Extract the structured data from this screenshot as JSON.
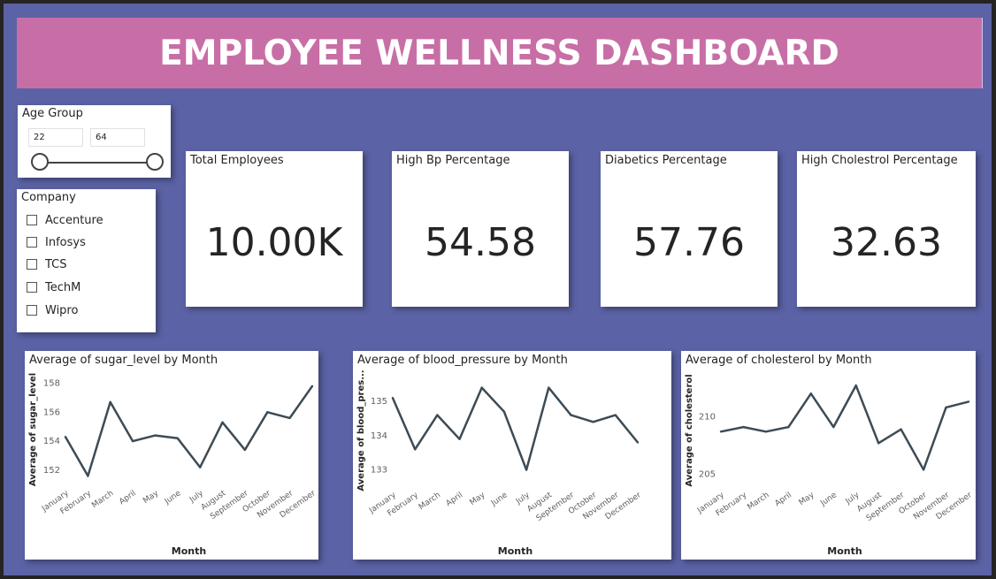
{
  "dashboard": {
    "title": "EMPLOYEE WELLNESS DASHBOARD"
  },
  "colors": {
    "background": "#5b62a5",
    "title_band": "#c86ea6",
    "line": "#3d4b55",
    "card": "#ffffff"
  },
  "age_slicer": {
    "title": "Age Group",
    "min": "22",
    "max": "64"
  },
  "company_slicer": {
    "title": "Company",
    "items": [
      {
        "label": "Accenture"
      },
      {
        "label": "Infosys"
      },
      {
        "label": "TCS"
      },
      {
        "label": "TechM"
      },
      {
        "label": "Wipro"
      }
    ]
  },
  "kpis": [
    {
      "label": "Total Employees",
      "value": "10.00K"
    },
    {
      "label": "High Bp Percentage",
      "value": "54.58"
    },
    {
      "label": "Diabetics Percentage",
      "value": "57.76"
    },
    {
      "label": "High Cholestrol Percentage",
      "value": "32.63"
    }
  ],
  "chart_data": [
    {
      "type": "line",
      "title": "Average of sugar_level by Month",
      "xlabel": "Month",
      "ylabel": "Average of sugar_level",
      "categories": [
        "January",
        "February",
        "March",
        "April",
        "May",
        "June",
        "July",
        "August",
        "September",
        "October",
        "November",
        "December"
      ],
      "values": [
        154.3,
        151.6,
        156.7,
        154.0,
        154.4,
        154.2,
        152.2,
        155.3,
        153.4,
        156.0,
        155.6,
        157.8
      ],
      "yticks": [
        "152",
        "154",
        "156",
        "158"
      ],
      "ylim": [
        151.2,
        158.4
      ]
    },
    {
      "type": "line",
      "title": "Average of blood_pressure by Month",
      "xlabel": "Month",
      "ylabel": "Average of blood_pres...",
      "categories": [
        "January",
        "February",
        "March",
        "April",
        "May",
        "June",
        "July",
        "August",
        "September",
        "October",
        "November",
        "December"
      ],
      "values": [
        135.1,
        133.6,
        134.6,
        133.9,
        135.4,
        134.7,
        133.0,
        135.4,
        134.6,
        134.4,
        134.6,
        133.8
      ],
      "yticks": [
        "133",
        "134",
        "135"
      ],
      "ylim": [
        132.6,
        135.7
      ]
    },
    {
      "type": "line",
      "title": "Average of cholesterol by Month",
      "xlabel": "Month",
      "ylabel": "Average of cholesterol",
      "categories": [
        "January",
        "February",
        "March",
        "April",
        "May",
        "June",
        "July",
        "August",
        "September",
        "October",
        "November",
        "December"
      ],
      "values": [
        208.7,
        209.1,
        208.7,
        209.1,
        212.0,
        209.1,
        212.7,
        207.7,
        208.9,
        205.4,
        210.8,
        211.3
      ],
      "yticks": [
        "205",
        "210"
      ],
      "ylim": [
        204.2,
        213.4
      ]
    }
  ]
}
